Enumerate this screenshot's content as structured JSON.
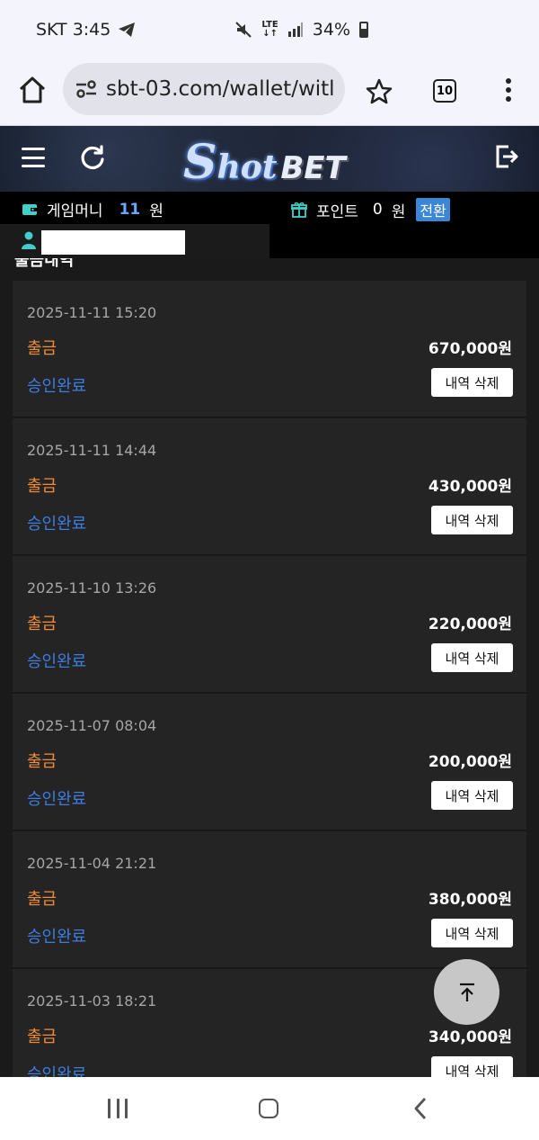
{
  "status_bar": {
    "carrier_time": "SKT 3:45",
    "network": "LTE",
    "battery": "34%"
  },
  "browser": {
    "url": "sbt-03.com/wallet/witl",
    "tab_count": "10"
  },
  "site": {
    "logo_s": "S",
    "logo_hot": "hot",
    "logo_bet": "BET"
  },
  "account": {
    "game_money_label": "게임머니",
    "game_money_value": "11",
    "game_money_unit": "원",
    "point_label": "포인트",
    "point_value": "0",
    "point_unit": "원",
    "convert_label": "전환"
  },
  "section": {
    "title": "출금내역"
  },
  "withdrawals": [
    {
      "date": "2025-11-11 15:20",
      "type": "출금",
      "amount": "670,000원",
      "status": "승인완료",
      "delete_label": "내역 삭제"
    },
    {
      "date": "2025-11-11 14:44",
      "type": "출금",
      "amount": "430,000원",
      "status": "승인완료",
      "delete_label": "내역 삭제"
    },
    {
      "date": "2025-11-10 13:26",
      "type": "출금",
      "amount": "220,000원",
      "status": "승인완료",
      "delete_label": "내역 삭제"
    },
    {
      "date": "2025-11-07 08:04",
      "type": "출금",
      "amount": "200,000원",
      "status": "승인완료",
      "delete_label": "내역 삭제"
    },
    {
      "date": "2025-11-04 21:21",
      "type": "출금",
      "amount": "380,000원",
      "status": "승인완료",
      "delete_label": "내역 삭제"
    },
    {
      "date": "2025-11-03 18:21",
      "type": "출금",
      "amount": "340,000원",
      "status": "승인완료",
      "delete_label": "내역 삭제"
    }
  ],
  "colors": {
    "withdraw_type": "#f08c3a",
    "status_approved": "#3d7de0",
    "money_value": "#6aa8ff",
    "convert_button": "#3c86d6",
    "card_background": "#242424"
  }
}
